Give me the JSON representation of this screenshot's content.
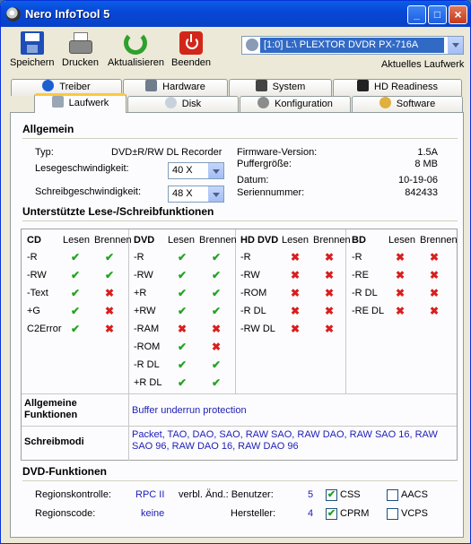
{
  "window": {
    "title": "Nero InfoTool 5"
  },
  "toolbar": {
    "save": "Speichern",
    "print": "Drucken",
    "refresh": "Aktualisieren",
    "quit": "Beenden",
    "drive_value": "[1:0]  L:\\ PLEXTOR  DVDR   PX-716A",
    "drive_caption": "Aktuelles Laufwerk"
  },
  "tabs_row1": [
    "Treiber",
    "Hardware",
    "System",
    "HD Readiness"
  ],
  "tabs_row2": [
    "Laufwerk",
    "Disk",
    "Konfiguration",
    "Software"
  ],
  "general": {
    "title": "Allgemein",
    "type_label": "Typ:",
    "type_value": "DVD±R/RW DL Recorder",
    "read_label": "Lesegeschwindigkeit:",
    "read_value": "40 X",
    "write_label": "Schreibgeschwindigkeit:",
    "write_value": "48 X",
    "fw_label": "Firmware-Version:",
    "fw_value": "1.5A",
    "buf_label": "Puffergröße:",
    "buf_value": "8 MB",
    "date_label": "Datum:",
    "date_value": "10-19-06",
    "serial_label": "Seriennummer:",
    "serial_value": "842433"
  },
  "rw": {
    "title": "Unterstützte Lese-/Schreibfunktionen",
    "read_col": "Lesen",
    "write_col": "Brennen",
    "cd": {
      "name": "CD",
      "rows": [
        [
          "-R",
          "ok",
          "ok"
        ],
        [
          "-RW",
          "ok",
          "ok"
        ],
        [
          "-Text",
          "ok",
          "no"
        ],
        [
          "+G",
          "ok",
          "no"
        ],
        [
          "C2Error",
          "ok",
          "no"
        ]
      ]
    },
    "dvd": {
      "name": "DVD",
      "rows": [
        [
          "-R",
          "ok",
          "ok"
        ],
        [
          "-RW",
          "ok",
          "ok"
        ],
        [
          "+R",
          "ok",
          "ok"
        ],
        [
          "+RW",
          "ok",
          "ok"
        ],
        [
          "-RAM",
          "no",
          "no"
        ],
        [
          "-ROM",
          "ok",
          "no"
        ],
        [
          "-R DL",
          "ok",
          "ok"
        ],
        [
          "+R DL",
          "ok",
          "ok"
        ]
      ]
    },
    "hddvd": {
      "name": "HD DVD",
      "rows": [
        [
          "-R",
          "no",
          "no"
        ],
        [
          "-RW",
          "no",
          "no"
        ],
        [
          "-ROM",
          "no",
          "no"
        ],
        [
          "-R DL",
          "no",
          "no"
        ],
        [
          "-RW DL",
          "no",
          "no"
        ]
      ]
    },
    "bd": {
      "name": "BD",
      "rows": [
        [
          "-R",
          "no",
          "no"
        ],
        [
          "-RE",
          "no",
          "no"
        ],
        [
          "-R DL",
          "no",
          "no"
        ],
        [
          "-RE DL",
          "no",
          "no"
        ]
      ]
    },
    "general_functions_label": "Allgemeine Funktionen",
    "general_functions_value": "Buffer underrun protection",
    "write_modes_label": "Schreibmodi",
    "write_modes_value": "Packet, TAO, DAO, SAO, RAW SAO, RAW DAO, RAW SAO 16, RAW SAO 96, RAW DAO 16, RAW DAO 96"
  },
  "dvd_functions": {
    "title": "DVD-Funktionen",
    "region_control_label": "Regionskontrolle:",
    "region_control_value": "RPC II",
    "region_code_label": "Regionscode:",
    "region_code_value": "keine",
    "changes_label": "verbl. Änd.: Benutzer:",
    "changes_value": "5",
    "vendor_label": "Hersteller:",
    "vendor_value": "4",
    "checkboxes": [
      {
        "label": "CSS",
        "checked": true
      },
      {
        "label": "CPRM",
        "checked": true
      },
      {
        "label": "AACS",
        "checked": false
      },
      {
        "label": "VCPS",
        "checked": false
      }
    ]
  },
  "colors": {
    "ok": "#22a422",
    "no": "#d81f1f",
    "title_bar": "#0a5ee8",
    "tab_active_accent": "#ffc83c"
  }
}
